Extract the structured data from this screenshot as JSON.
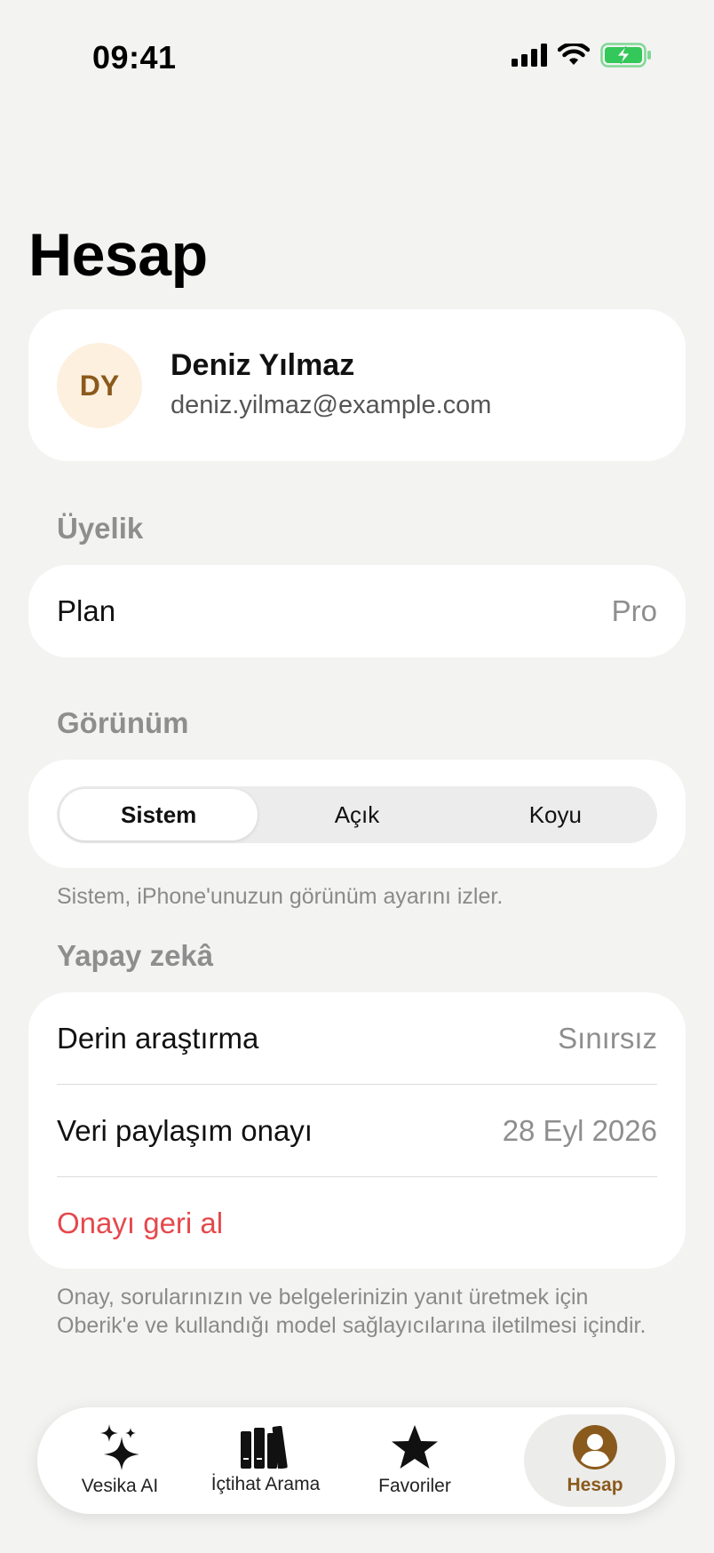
{
  "status_bar": {
    "time": "09:41"
  },
  "page": {
    "title": "Hesap"
  },
  "profile": {
    "initials": "DY",
    "name": "Deniz Yılmaz",
    "email": "deniz.yilmaz@example.com"
  },
  "membership": {
    "header": "Üyelik",
    "plan_label": "Plan",
    "plan_value": "Pro"
  },
  "appearance": {
    "header": "Görünüm",
    "options": [
      "Sistem",
      "Açık",
      "Koyu"
    ],
    "selected": "Sistem",
    "footnote": "Sistem, iPhone'unuzun görünüm ayarını izler."
  },
  "ai": {
    "header": "Yapay zekâ",
    "deep_research_label": "Derin araştırma",
    "deep_research_value": "Sınırsız",
    "consent_label": "Veri paylaşım onayı",
    "consent_value": "28 Eyl 2026",
    "revoke_label": "Onayı geri al",
    "footnote": "Onay, sorularınızın ve belgelerinizin yanıt üretmek için Oberik'e ve kullandığı model sağlayıcılarına iletilmesi içindir."
  },
  "tab_bar": {
    "items": [
      {
        "label": "Vesika AI",
        "icon": "sparkles-icon"
      },
      {
        "label": "İçtihat Arama",
        "icon": "books-icon"
      },
      {
        "label": "Favoriler",
        "icon": "star-icon"
      },
      {
        "label": "Hesap",
        "icon": "person-circle-icon"
      }
    ],
    "active": "Hesap"
  },
  "colors": {
    "accent": "#8a5a1c",
    "avatar_bg": "#fdf0df",
    "destructive": "#e5484d",
    "background": "#f3f3f2",
    "battery": "#34c759"
  }
}
